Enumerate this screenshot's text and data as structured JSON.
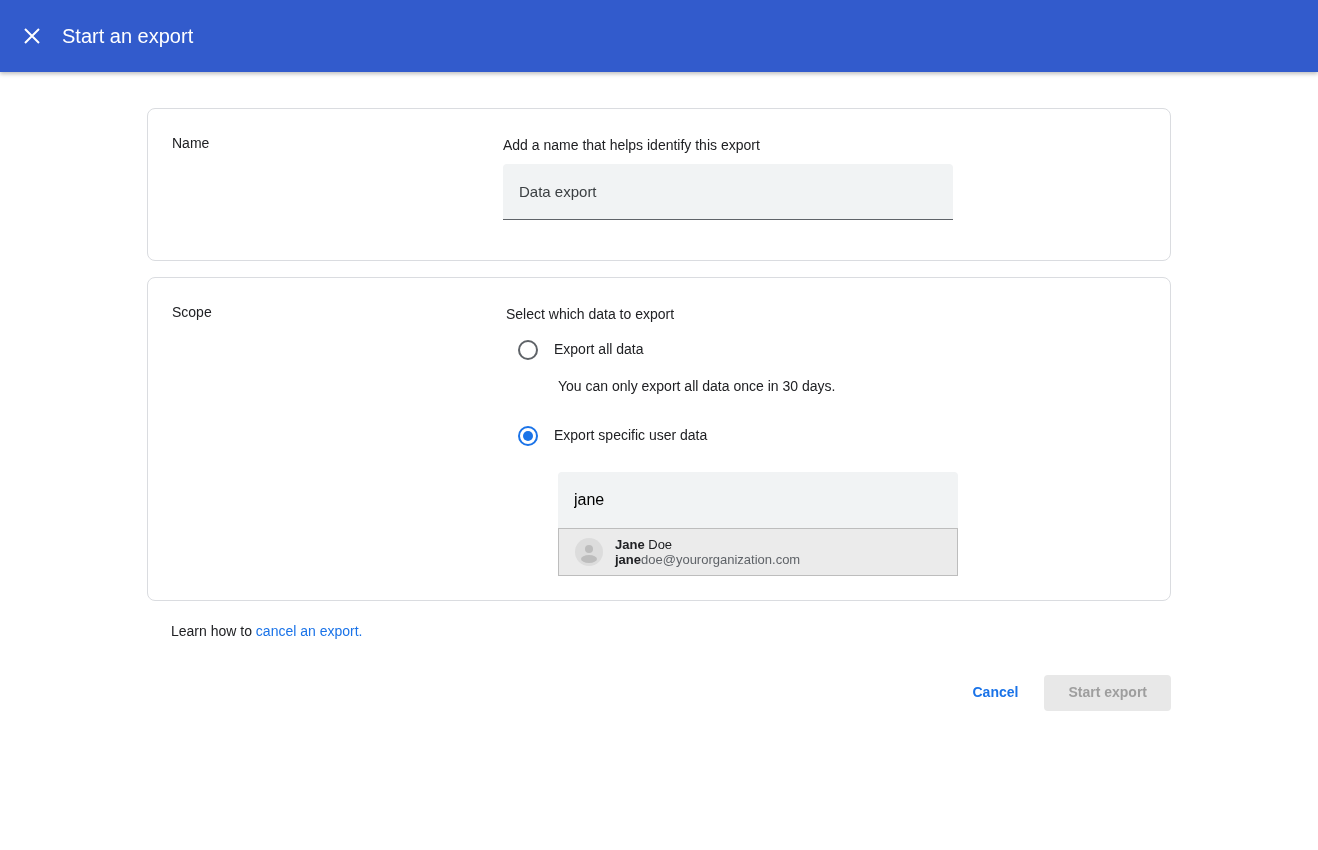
{
  "app_bar": {
    "title": "Start an export"
  },
  "name_section": {
    "label": "Name",
    "hint": "Add a name that helps identify this export",
    "field": {
      "value": "Data export"
    }
  },
  "scope_section": {
    "label": "Scope",
    "hint": "Select which data to export",
    "options": [
      {
        "label": "Export all data",
        "selected": false,
        "note": "You can only export all data once in 30 days."
      },
      {
        "label": "Export specific user data",
        "selected": true
      }
    ],
    "user_search": {
      "value": "jane",
      "suggestions": [
        {
          "name": "**Jane** Doe",
          "email": "**jane**doe@yourorganization.com"
        }
      ]
    }
  },
  "footer_note": {
    "text": "Learn how to",
    "link": "cancel an export."
  },
  "buttons": [
    {
      "label": "Cancel",
      "kind": "text",
      "disabled": false
    },
    {
      "label": "Start export",
      "kind": "filled",
      "disabled": true
    }
  ]
}
